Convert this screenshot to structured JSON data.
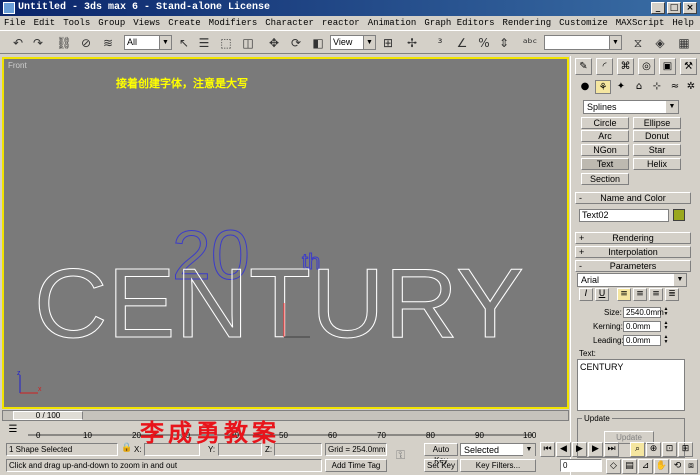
{
  "window": {
    "title": "Untitled - 3ds max 6 - Stand-alone License"
  },
  "menu": [
    "File",
    "Edit",
    "Tools",
    "Group",
    "Views",
    "Create",
    "Modifiers",
    "Character",
    "reactor",
    "Animation",
    "Graph Editors",
    "Rendering",
    "Customize",
    "MAXScript",
    "Help"
  ],
  "toolbar": {
    "selection_filter": "All",
    "ref_coord": "View",
    "named_sets": ""
  },
  "viewport": {
    "label": "Front",
    "caption": "接着创建字体，注意是大写",
    "text_main": "CENTURY",
    "text_small": "20",
    "text_sup": "th",
    "axis_x": "x",
    "axis_z": "z"
  },
  "panel": {
    "category": "Splines",
    "object_types": [
      "Circle",
      "Ellipse",
      "Arc",
      "Donut",
      "NGon",
      "Star",
      "Text",
      "Helix",
      "Section"
    ],
    "name_color_title": "Name and Color",
    "object_name": "Text02",
    "object_color": "#9aa81e",
    "rollouts": {
      "rendering": "Rendering",
      "interpolation": "Interpolation",
      "parameters": "Parameters"
    },
    "font": "Arial",
    "size_label": "Size:",
    "size_value": "2540.0mm",
    "kerning_label": "Kerning:",
    "kerning_value": "0.0mm",
    "leading_label": "Leading:",
    "leading_value": "0.0mm",
    "text_label": "Text:",
    "text_value": "CENTURY",
    "update_title": "Update",
    "update_button": "Update"
  },
  "timeline": {
    "frame": "0 / 100",
    "ticks": [
      "0",
      "10",
      "20",
      "30",
      "40",
      "50",
      "60",
      "70",
      "80",
      "90",
      "100"
    ]
  },
  "status": {
    "selection": "1 Shape Selected",
    "prompt": "Click and drag up-and-down to zoom in and out",
    "x_label": "X:",
    "y_label": "Y:",
    "z_label": "Z:",
    "grid": "Grid = 254.0mm",
    "add_time_tag": "Add Time Tag",
    "auto_key": "Auto Key",
    "set_key": "Set Key",
    "key_mode": "Selected",
    "key_filters": "Key Filters...",
    "current_frame": "0"
  },
  "watermark": "李成勇教案",
  "colors": {
    "viewport_bg": "#7a7a7a",
    "active_border": "#f1e300",
    "caption": "#ffff00",
    "selected_shape": "#3c3cc8",
    "watermark": "#e8141b"
  }
}
